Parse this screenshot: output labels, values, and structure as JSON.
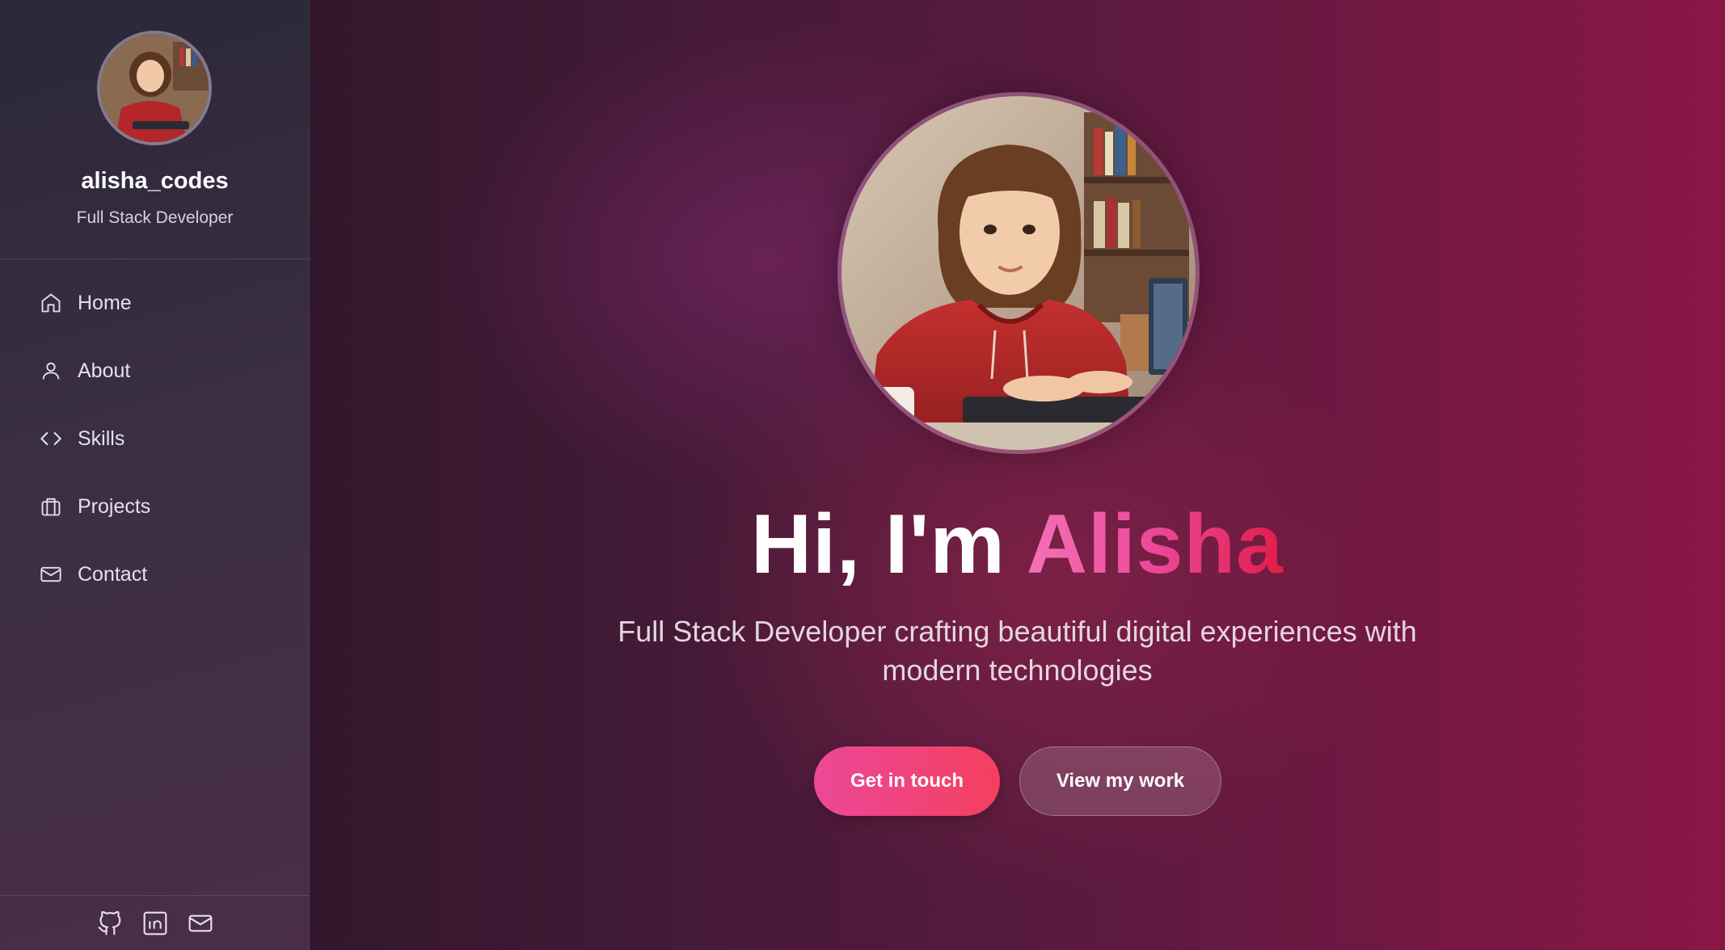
{
  "sidebar": {
    "avatar_alt": "profile-photo",
    "username": "alisha_codes",
    "role": "Full Stack Developer",
    "nav": [
      {
        "label": "Home",
        "icon": "home-icon"
      },
      {
        "label": "About",
        "icon": "user-icon"
      },
      {
        "label": "Skills",
        "icon": "code-icon"
      },
      {
        "label": "Projects",
        "icon": "briefcase-icon"
      },
      {
        "label": "Contact",
        "icon": "mail-icon"
      }
    ],
    "social": [
      "github-icon",
      "linkedin-icon",
      "mail-icon"
    ]
  },
  "hero": {
    "greeting": "Hi, I'm ",
    "name": "Alisha",
    "subtitle": "Full Stack Developer crafting beautiful digital experiences with modern technologies",
    "primary_button": "Get in touch",
    "secondary_button": "View my work"
  },
  "colors": {
    "accent_start": "#ec4899",
    "accent_end": "#f43f5e",
    "background_dark": "#33172c",
    "background_accent": "#8a1646"
  }
}
